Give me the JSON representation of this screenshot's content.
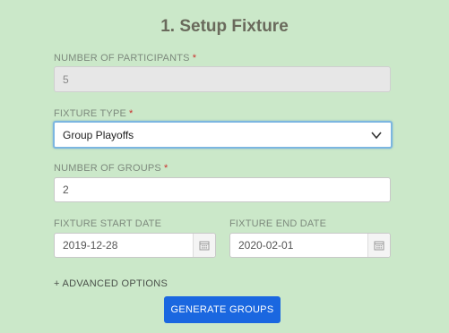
{
  "title": "1. Setup Fixture",
  "participants": {
    "label": "NUMBER OF PARTICIPANTS",
    "required_mark": "*",
    "value": "5"
  },
  "fixture_type": {
    "label": "FIXTURE TYPE",
    "required_mark": "*",
    "selected": "Group Playoffs"
  },
  "groups": {
    "label": "NUMBER OF GROUPS",
    "required_mark": "*",
    "value": "2"
  },
  "start_date": {
    "label": "FIXTURE START DATE",
    "value": "2019-12-28"
  },
  "end_date": {
    "label": "FIXTURE END DATE",
    "value": "2020-02-01"
  },
  "advanced_options": "+ ADVANCED OPTIONS",
  "generate_button": "GENERATE GROUPS",
  "icons": {
    "select": "chevron-down-icon",
    "calendar": "calendar-icon"
  },
  "colors": {
    "background": "#cbe8c9",
    "primary_button": "#1a67e0",
    "required": "#c9302c",
    "focus_border": "#7cb6e0"
  }
}
